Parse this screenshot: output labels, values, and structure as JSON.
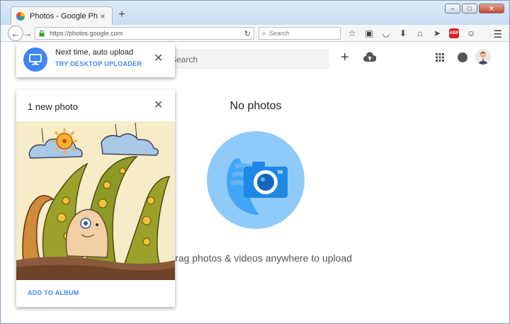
{
  "browser": {
    "tab_title": "Photos - Google Photos",
    "tab_close": "×",
    "new_tab": "+",
    "url": "https://photos.google.com",
    "search_placeholder": "Search",
    "window_min": "–",
    "window_max": "□",
    "window_close": "✕"
  },
  "header": {
    "search_placeholder": "Search",
    "add_label": "+"
  },
  "empty_state": {
    "title": "No photos",
    "hint": "Drag photos & videos anywhere to upload"
  },
  "notifications": {
    "auto_upload": {
      "title": "Next time, auto upload",
      "link": "TRY DESKTOP UPLOADER",
      "close": "✕"
    },
    "new_photo": {
      "title": "1 new photo",
      "link": "ADD TO ALBUM",
      "close": "✕"
    }
  },
  "colors": {
    "accent": "#4285f4",
    "camera_bg": "#90caf9"
  }
}
